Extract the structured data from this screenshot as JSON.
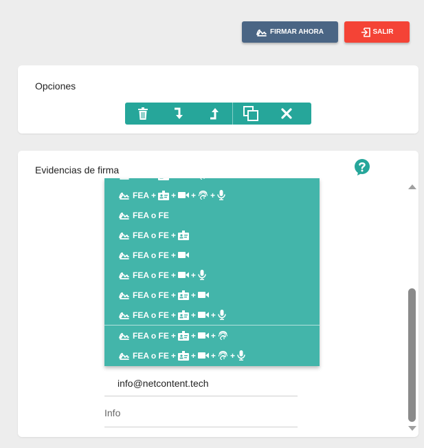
{
  "header": {
    "sign_button_label": "FIRMAR AHORA",
    "exit_button_label": "SALIR"
  },
  "options": {
    "title": "Opciones",
    "toolbar": [
      "trash-icon",
      "arrow-down-turn-icon",
      "arrow-up-turn-icon",
      "copy-icon",
      "close-icon"
    ]
  },
  "evidence": {
    "title": "Evidencias de firma",
    "items": [
      {
        "label": "FEA",
        "parts": [
          "id-card",
          "video",
          "fingerprint"
        ]
      },
      {
        "label": "FEA",
        "parts": [
          "id-card",
          "video",
          "fingerprint",
          "mic"
        ]
      },
      {
        "label": "FEA o FE",
        "parts": []
      },
      {
        "label": "FEA o FE",
        "parts": [
          "id-card"
        ]
      },
      {
        "label": "FEA o FE",
        "parts": [
          "video"
        ]
      },
      {
        "label": "FEA o FE",
        "parts": [
          "video",
          "mic"
        ]
      },
      {
        "label": "FEA o FE",
        "parts": [
          "id-card",
          "video"
        ]
      },
      {
        "label": "FEA o FE",
        "parts": [
          "id-card",
          "video",
          "mic"
        ]
      },
      {
        "label": "FEA o FE",
        "parts": [
          "id-card",
          "video",
          "fingerprint"
        ]
      },
      {
        "label": "FEA o FE",
        "parts": [
          "id-card",
          "video",
          "fingerprint",
          "mic"
        ]
      }
    ],
    "email_value": "info@netcontent.tech",
    "info_placeholder": "Info"
  },
  "colors": {
    "accent": "#26a69a",
    "dropdown": "#43b5aa",
    "sign_button": "#4a6584",
    "exit_button": "#f44336"
  }
}
